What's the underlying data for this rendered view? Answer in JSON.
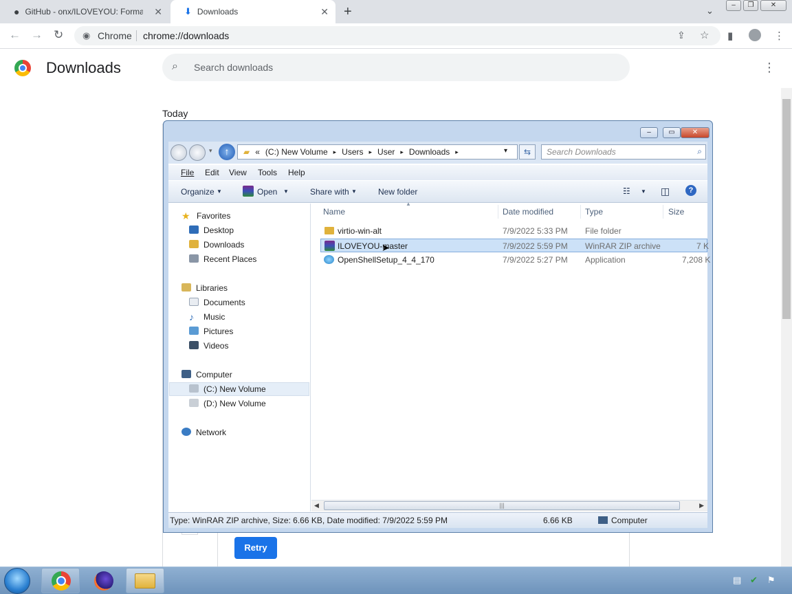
{
  "chrome": {
    "tabs": [
      {
        "title": "GitHub - onx/ILOVEYOU: Formatt",
        "icon": "github-icon",
        "active": false
      },
      {
        "title": "Downloads",
        "icon": "download-icon",
        "active": true
      }
    ],
    "omnibox": {
      "site_label": "Chrome",
      "url": "chrome://downloads"
    }
  },
  "downloads_page": {
    "title": "Downloads",
    "search_placeholder": "Search downloads",
    "section_today": "Today",
    "retry_label": "Retry"
  },
  "explorer": {
    "breadcrumb": [
      "«",
      "(C:) New Volume",
      "▸",
      "Users",
      "▸",
      "User",
      "▸",
      "Downloads",
      "▸"
    ],
    "search_placeholder": "Search Downloads",
    "menu": [
      "File",
      "Edit",
      "View",
      "Tools",
      "Help"
    ],
    "commands": {
      "organize": "Organize",
      "open": "Open",
      "share_with": "Share with",
      "new_folder": "New folder"
    },
    "nav": {
      "favorites": "Favorites",
      "desktop": "Desktop",
      "downloads": "Downloads",
      "recent_places": "Recent Places",
      "libraries": "Libraries",
      "documents": "Documents",
      "music": "Music",
      "pictures": "Pictures",
      "videos": "Videos",
      "computer": "Computer",
      "c_drive": "(C:) New Volume",
      "d_drive": "(D:) New Volume",
      "network": "Network"
    },
    "columns": {
      "name": "Name",
      "date": "Date modified",
      "type": "Type",
      "size": "Size"
    },
    "files": [
      {
        "name": "virtio-win-alt",
        "date": "7/9/2022 5:33 PM",
        "type": "File folder",
        "size": "",
        "selected": false
      },
      {
        "name": "ILOVEYOU-master",
        "date": "7/9/2022 5:59 PM",
        "type": "WinRAR ZIP archive",
        "size": "7 K",
        "selected": true
      },
      {
        "name": "OpenShellSetup_4_4_170",
        "date": "7/9/2022 5:27 PM",
        "type": "Application",
        "size": "7,208 K",
        "selected": false
      }
    ],
    "status": {
      "details": "Type: WinRAR ZIP archive, Size: 6.66 KB, Date modified: 7/9/2022 5:59 PM",
      "size": "6.66 KB",
      "location": "Computer"
    }
  },
  "colors": {
    "chrome_blue": "#1a73e8",
    "selection": "#cce1f7",
    "explorer_frame": "#c4d7ee"
  }
}
